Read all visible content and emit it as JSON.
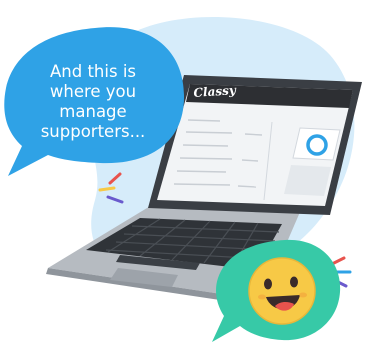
{
  "speech_bubble": {
    "lines": [
      "And this is",
      "where you",
      "manage",
      "supporters..."
    ],
    "color": "#2fa2e6"
  },
  "laptop": {
    "brand_logo": "Classy",
    "screen_header_color": "#2d2f33",
    "body_color": "#a9aeb4"
  },
  "mascot": {
    "face_color": "#f7c946",
    "bubble_color": "#37c9a7"
  },
  "background_blob_color": "#d6ecfa"
}
